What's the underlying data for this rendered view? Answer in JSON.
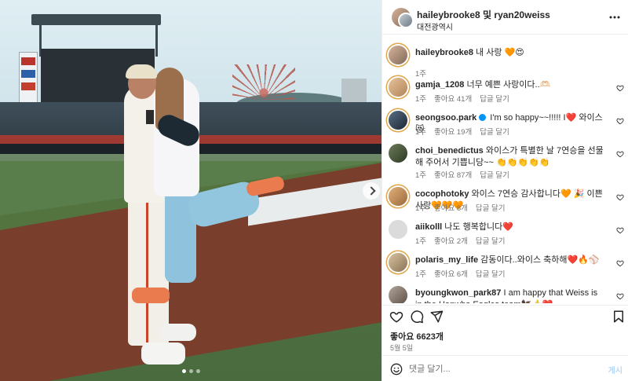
{
  "photo": {
    "description_alt": "",
    "carousel": {
      "count": 3,
      "active": 1
    }
  },
  "header": {
    "title": "haileybrooke8 및 ryan20weiss",
    "location": "대전광역시",
    "more_icon": "more-horizontal-icon"
  },
  "caption": {
    "username": "haileybrooke8",
    "text": " 내 사랑 🧡😍",
    "time": "1주"
  },
  "comments": [
    {
      "username": "gamja_1208",
      "text": " 너무 예쁜 사랑이다..🫶🏻",
      "time": "1주",
      "likes": "좋아요 41개",
      "reply": "답글 달기",
      "verified": false
    },
    {
      "username": "seongsoo.park",
      "text": " I'm so happy~~!!!!! I❤️ 와이스😻",
      "time": "1주",
      "likes": "좋아요 19개",
      "reply": "답글 달기",
      "verified": true
    },
    {
      "username": "choi_benedictus",
      "text": " 와이스가 특별한 날 7연승을 선물해 주어서 기쁩니당~~ 👏👏👏👏👏",
      "time": "1주",
      "likes": "좋아요 87개",
      "reply": "답글 달기",
      "verified": false
    },
    {
      "username": "cocophotoky",
      "text": " 와이스 7연승 감사합니다🧡 🎉 이쁜 사랑🧡🧡🧡",
      "time": "1주",
      "likes": "좋아요 8개",
      "reply": "답글 달기",
      "verified": false
    },
    {
      "username": "aiikolll",
      "text": " 나도 행복합니다❤️",
      "time": "1주",
      "likes": "좋아요 2개",
      "reply": "답글 달기",
      "verified": false
    },
    {
      "username": "polaris_my_life",
      "text": " 감동이다..와이스 축하해❤️🔥⚾",
      "time": "1주",
      "likes": "좋아요 6개",
      "reply": "답글 달기",
      "verified": false
    },
    {
      "username": "byoungkwon_park87",
      "text": " I am happy that Weiss is in the Hanwha Eagles team🦅👍❤️",
      "time": "",
      "likes": "",
      "reply": "",
      "verified": false
    }
  ],
  "actions": {
    "like_icon": "heart-icon",
    "comment_icon": "comment-icon",
    "share_icon": "send-icon",
    "save_icon": "bookmark-icon"
  },
  "likes_text": "좋아요 6623개",
  "date_text": "5월 5일",
  "composer": {
    "placeholder": "댓글 달기...",
    "post_label": "게시",
    "emoji_icon": "emoji-smile-icon"
  },
  "colors": {
    "accent": "#0095f6",
    "muted": "#737373",
    "heart_red": "#ed4956"
  }
}
